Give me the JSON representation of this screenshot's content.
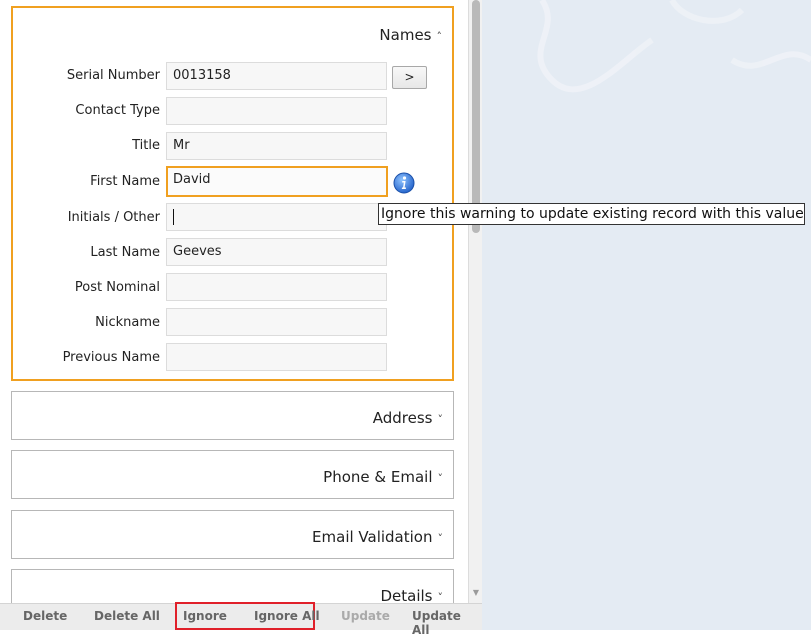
{
  "names_section": {
    "title": "Names",
    "fields": [
      {
        "label": "Serial Number",
        "value": "0013158"
      },
      {
        "label": "Contact Type",
        "value": ""
      },
      {
        "label": "Title",
        "value": "Mr"
      },
      {
        "label": "First Name",
        "value": "David"
      },
      {
        "label": "Initials / Other",
        "value": ""
      },
      {
        "label": "Last Name",
        "value": "Geeves"
      },
      {
        "label": "Post Nominal",
        "value": ""
      },
      {
        "label": "Nickname",
        "value": ""
      },
      {
        "label": "Previous Name",
        "value": ""
      }
    ],
    "go_button": ">"
  },
  "tooltip": "Ignore this warning to update existing record with this value",
  "collapsed_sections": [
    "Address",
    "Phone & Email",
    "Email Validation",
    "Details"
  ],
  "bottom_bar": {
    "delete": "Delete",
    "delete_all": "Delete All",
    "ignore": "Ignore",
    "ignore_all": "Ignore All",
    "update": "Update",
    "update_all": "Update All"
  },
  "icons": {
    "chevron_up": "chevron-up-icon",
    "chevron_down": "chevron-down-icon",
    "info": "info-icon"
  },
  "colors": {
    "focus_border": "#f0a020",
    "highlight_box": "#e0202a",
    "info_blue": "#2a6fd6"
  }
}
